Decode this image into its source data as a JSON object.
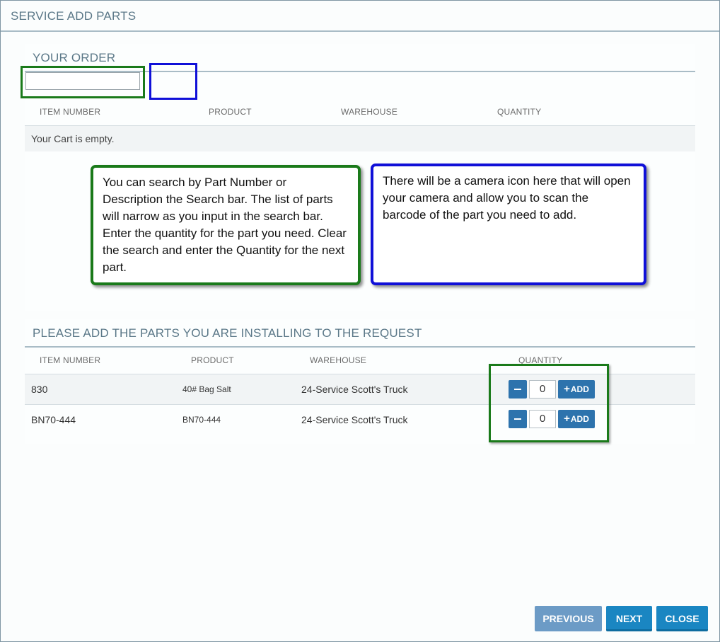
{
  "window": {
    "title": "SERVICE ADD PARTS"
  },
  "order": {
    "title": "YOUR ORDER",
    "search_value": "",
    "columns": [
      "ITEM NUMBER",
      "PRODUCT",
      "WAREHOUSE",
      "QUANTITY"
    ],
    "empty_text": "Your Cart is empty."
  },
  "callouts": {
    "search_help": "You can search by Part Number or Description the Search bar. The list of parts will narrow as you input in the search bar. Enter the quantity for the part you need. Clear the search and enter the Quantity for the next part.",
    "camera_help": "There will be a camera icon here that will open your camera and allow you to scan the barcode of the part you need to add."
  },
  "parts": {
    "title": "PLEASE ADD THE PARTS YOU ARE INSTALLING TO THE REQUEST",
    "columns": [
      "ITEM NUMBER",
      "PRODUCT",
      "WAREHOUSE",
      "QUANTITY"
    ],
    "rows": [
      {
        "item_number": "830",
        "product": "40# Bag Salt",
        "warehouse": "24-Service Scott's Truck",
        "quantity": "0"
      },
      {
        "item_number": "BN70-444",
        "product": "BN70-444",
        "warehouse": "24-Service Scott's Truck",
        "quantity": "0"
      }
    ],
    "add_label": "ADD",
    "plus_icon": "+"
  },
  "footer": {
    "previous_label": "PREVIOUS",
    "next_label": "NEXT",
    "close_label": "CLOSE"
  },
  "colors": {
    "title_text": "#5b7888",
    "button_blue": "#2d73ad",
    "footer_blue": "#1a86c2",
    "highlight_green": "#1a7a1a",
    "highlight_blue": "#1010d8"
  }
}
